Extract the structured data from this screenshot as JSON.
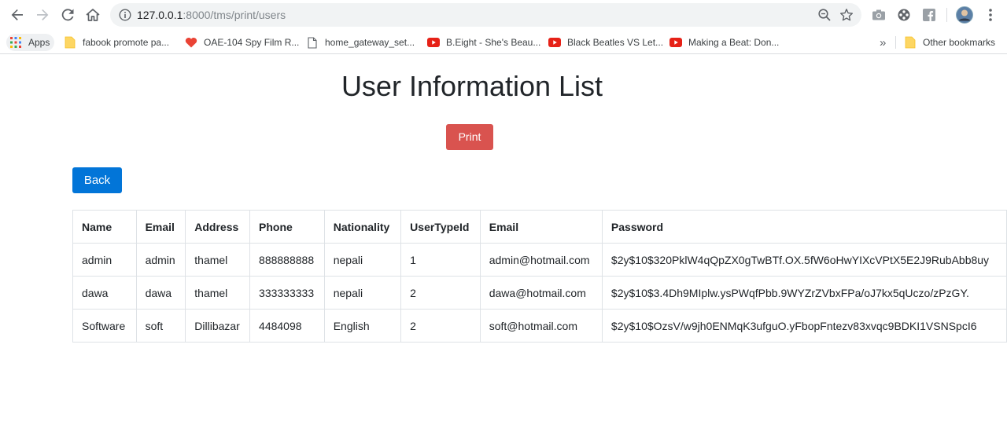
{
  "browser": {
    "url_host": "127.0.0.1",
    "url_rest": ":8000/tms/print/users",
    "bookmarks": [
      {
        "label": "Apps",
        "icon": "apps-grid-icon"
      },
      {
        "label": "fabook promote pa...",
        "icon": "folder-icon"
      },
      {
        "label": "OAE-104 Spy Film R...",
        "icon": "heart-icon"
      },
      {
        "label": "home_gateway_set...",
        "icon": "page-icon"
      },
      {
        "label": "B.Eight - She's Beau...",
        "icon": "youtube-icon"
      },
      {
        "label": "Black Beatles VS Let...",
        "icon": "youtube-icon"
      },
      {
        "label": "Making a Beat: Don...",
        "icon": "youtube-icon"
      }
    ],
    "overflow_label": "»",
    "other_bookmarks": "Other bookmarks"
  },
  "page": {
    "title": "User Information List",
    "print_label": "Print",
    "back_label": "Back"
  },
  "table": {
    "headers": [
      "Name",
      "Email",
      "Address",
      "Phone",
      "Nationality",
      "UserTypeId",
      "Email",
      "Password"
    ],
    "rows": [
      [
        "admin",
        "admin",
        "thamel",
        "888888888",
        "nepali",
        "1",
        "admin@hotmail.com",
        "$2y$10$320PklW4qQpZX0gTwBTf.OX.5fW6oHwYIXcVPtX5E2J9RubAbb8uy"
      ],
      [
        "dawa",
        "dawa",
        "thamel",
        "333333333",
        "nepali",
        "2",
        "dawa@hotmail.com",
        "$2y$10$3.4Dh9MIplw.ysPWqfPbb.9WYZrZVbxFPa/oJ7kx5qUczo/zPzGY."
      ],
      [
        "Software",
        "soft",
        "Dillibazar",
        "4484098",
        "English",
        "2",
        "soft@hotmail.com",
        "$2y$10$OzsV/w9jh0ENMqK3ufguO.yFbopFntezv83xvqc9BDKI1VSNSpcI6"
      ]
    ]
  },
  "colors": {
    "print_button": "#d9534f",
    "back_button": "#0275d8"
  }
}
